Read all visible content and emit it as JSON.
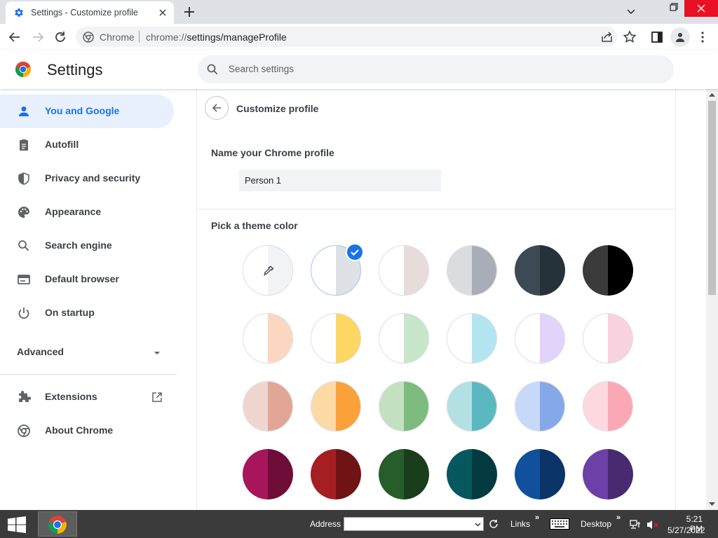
{
  "tab": {
    "title": "Settings - Customize profile"
  },
  "omnibox": {
    "site_chip": "Chrome",
    "url_prefix": "chrome://",
    "url_path": "settings/manageProfile"
  },
  "header": {
    "title": "Settings",
    "search_placeholder": "Search settings"
  },
  "sidebar": {
    "items": [
      {
        "label": "You and Google",
        "icon": "person-icon",
        "active": true
      },
      {
        "label": "Autofill",
        "icon": "clipboard-icon"
      },
      {
        "label": "Privacy and security",
        "icon": "shield-icon"
      },
      {
        "label": "Appearance",
        "icon": "palette-icon"
      },
      {
        "label": "Search engine",
        "icon": "search-icon"
      },
      {
        "label": "Default browser",
        "icon": "browser-icon"
      },
      {
        "label": "On startup",
        "icon": "power-icon"
      }
    ],
    "advanced_label": "Advanced",
    "extensions_label": "Extensions",
    "about_label": "About Chrome"
  },
  "main": {
    "page_title": "Customize profile",
    "name_label": "Name your Chrome profile",
    "name_value": "Person 1",
    "theme_label": "Pick a theme color",
    "selected_index": 1
  },
  "theme_colors": [
    {
      "left": "#ffffff",
      "right": "#f1f3f4",
      "custom": true
    },
    {
      "left": "#ffffff",
      "right": "#dee1e6"
    },
    {
      "left": "#ffffff",
      "right": "#e7dcd9"
    },
    {
      "left": "#dadce0",
      "right": "#a9adb7"
    },
    {
      "left": "#3c4a56",
      "right": "#26323a"
    },
    {
      "left": "#3b3b3b",
      "right": "#000000"
    },
    {
      "left": "#ffffff",
      "right": "#fbd7c2"
    },
    {
      "left": "#ffffff",
      "right": "#fdd663"
    },
    {
      "left": "#ffffff",
      "right": "#c8e6c9"
    },
    {
      "left": "#ffffff",
      "right": "#b3e5f0"
    },
    {
      "left": "#ffffff",
      "right": "#e2d3fb"
    },
    {
      "left": "#ffffff",
      "right": "#f8d3df"
    },
    {
      "left": "#f0d5cf",
      "right": "#e2a696"
    },
    {
      "left": "#fdd9a6",
      "right": "#fba13a"
    },
    {
      "left": "#c3e1c1",
      "right": "#7dbb7f"
    },
    {
      "left": "#b2e0e3",
      "right": "#5cb8c0"
    },
    {
      "left": "#c6d9f8",
      "right": "#85a9e8"
    },
    {
      "left": "#fdd8de",
      "right": "#fba8b6"
    },
    {
      "left": "#a7165b",
      "right": "#6e0d38"
    },
    {
      "left": "#a51e22",
      "right": "#701315"
    },
    {
      "left": "#275c2b",
      "right": "#1a3d1c"
    },
    {
      "left": "#07575f",
      "right": "#033a40"
    },
    {
      "left": "#11509c",
      "right": "#0b3468"
    },
    {
      "left": "#6d40a7",
      "right": "#482a70"
    }
  ],
  "taskbar": {
    "address_label": "Address",
    "links_label": "Links",
    "desktop_label": "Desktop",
    "time": "5:21 PM",
    "date": "5/27/2022"
  },
  "colors": {
    "accent": "#1a73e8",
    "active_nav_bg": "#e8f0fe",
    "close_button": "#e81123"
  }
}
